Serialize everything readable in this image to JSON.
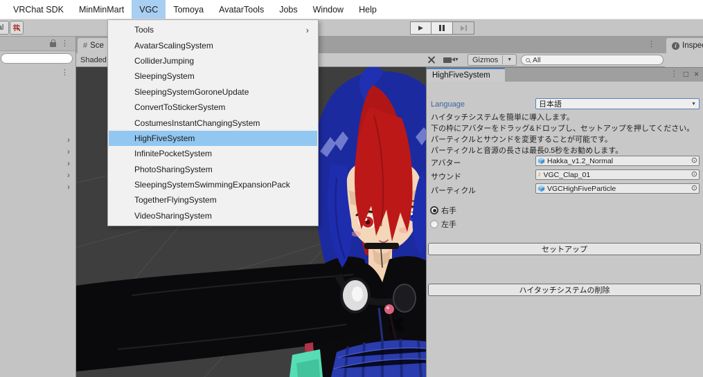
{
  "menubar": {
    "items": [
      "VRChat SDK",
      "MinMinMart",
      "VGC",
      "Tomoya",
      "AvatarTools",
      "Jobs",
      "Window",
      "Help"
    ],
    "active_item": "VGC"
  },
  "vgc_menu": {
    "items": [
      {
        "label": "Tools",
        "submenu": true
      },
      {
        "label": "AvatarScalingSystem"
      },
      {
        "label": "ColliderJumping"
      },
      {
        "label": "SleepingSystem"
      },
      {
        "label": "SleepingSystemGoroneUpdate"
      },
      {
        "label": "ConvertToStickerSystem"
      },
      {
        "label": "CostumesInstantChangingSystem"
      },
      {
        "label": "HighFiveSystem",
        "highlighted": true
      },
      {
        "label": "InfinitePocketSystem"
      },
      {
        "label": "PhotoSharingSystem"
      },
      {
        "label": "SleepingSystemSwimmingExpansionPack"
      },
      {
        "label": "TogetherFlyingSystem"
      },
      {
        "label": "VideoSharingSystem"
      }
    ]
  },
  "toolbar": {
    "partial_button": "al"
  },
  "scene_panel": {
    "tab": "Sce",
    "shading_mode": "Shaded",
    "gizmos_label": "Gizmos",
    "search_value": "All"
  },
  "inspector": {
    "tab": "Inspec"
  },
  "highfive": {
    "tab": "HighFiveSystem",
    "language_label": "Language",
    "language_value": "日本語",
    "description_lines": [
      "ハイタッチシステムを簡単に導入します。",
      "下の枠にアバターをドラッグ&ドロップし、セットアップを押してください。",
      "パーティクルとサウンドを変更することが可能です。",
      "パーティクルと音源の長さは最長0.5秒をお勧めします。"
    ],
    "fields": [
      {
        "label": "アバター",
        "value": "Hakka_v1.2_Normal",
        "icon": "prefab-cube-icon"
      },
      {
        "label": "サウンド",
        "value": "VGC_Clap_01",
        "icon": "audio-clip-icon"
      },
      {
        "label": "パーティクル",
        "value": "VGCHighFiveParticle",
        "icon": "prefab-cube-icon"
      }
    ],
    "radios": [
      {
        "label": "右手",
        "selected": true
      },
      {
        "label": "左手",
        "selected": false
      }
    ],
    "setup_button": "セットアップ",
    "delete_button": "ハイタッチシステムの削除"
  },
  "icons": {
    "play": "▶",
    "hash": "#",
    "kebab": "⋮",
    "maximize": "□",
    "close": "×",
    "picker": "⊙",
    "note": "♪",
    "dropdown": "▼",
    "small_dropdown": "▾",
    "submenu": "›",
    "chevron": "›",
    "info": "i"
  },
  "colors": {
    "menu_highlight": "#a8cef2",
    "dropdown_highlight": "#92c7f1",
    "active_tab_accent": "#4a7fc0",
    "language_label_blue": "#3b64a0",
    "scene_background": "#3e3e3e",
    "prefab_icon_blue": "#6db3e2",
    "audio_icon_gold": "#c79a2a",
    "avatar_hair_blue": "#1c2aa0",
    "avatar_hair_red": "#b01616"
  }
}
